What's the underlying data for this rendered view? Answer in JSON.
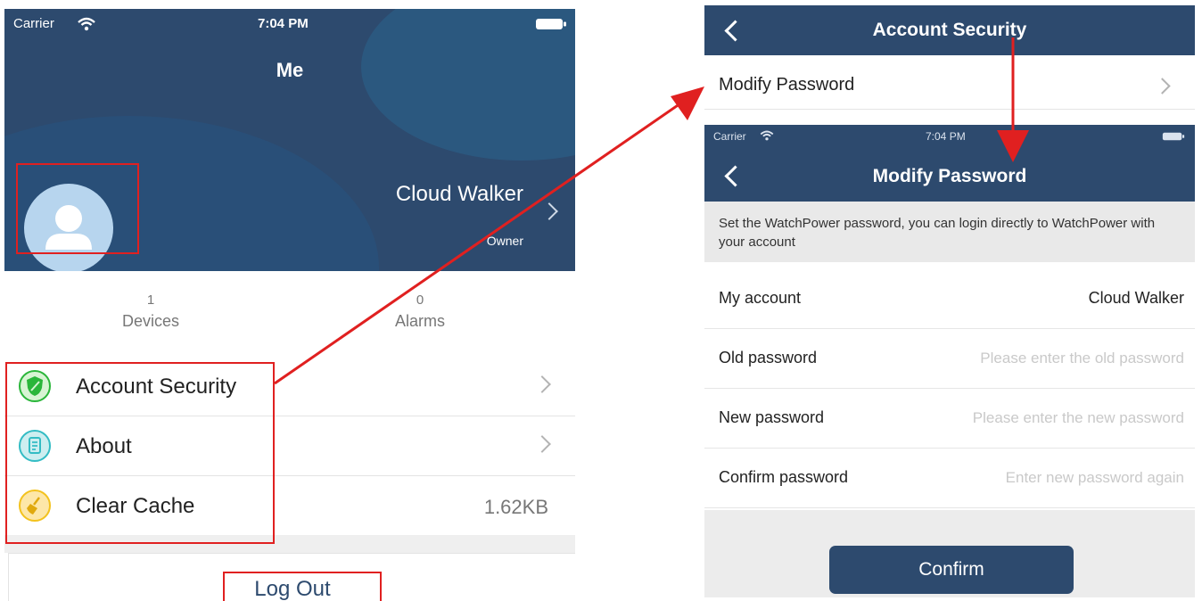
{
  "me": {
    "status": {
      "carrier": "Carrier",
      "time": "7:04 PM"
    },
    "title": "Me",
    "user": {
      "name": "Cloud Walker",
      "role": "Owner"
    },
    "stats": [
      {
        "value": "1",
        "label": "Devices"
      },
      {
        "value": "0",
        "label": "Alarms"
      }
    ],
    "menu": [
      {
        "label": "Account Security",
        "icon": "shield-icon"
      },
      {
        "label": "About",
        "icon": "document-icon"
      },
      {
        "label": "Clear Cache",
        "icon": "broom-icon",
        "value": "1.62KB"
      }
    ],
    "logout": "Log Out"
  },
  "account_security": {
    "title": "Account Security",
    "items": [
      {
        "label": "Modify Password"
      }
    ]
  },
  "modify_password": {
    "status": {
      "carrier": "Carrier",
      "time": "7:04 PM"
    },
    "title": "Modify Password",
    "info": "Set the WatchPower password, you can login directly to WatchPower with your account",
    "fields": [
      {
        "label": "My account",
        "value": "Cloud Walker"
      },
      {
        "label": "Old password",
        "placeholder": "Please enter the old password"
      },
      {
        "label": "New password",
        "placeholder": "Please enter the new password"
      },
      {
        "label": "Confirm password",
        "placeholder": "Enter new password again"
      }
    ],
    "confirm": "Confirm"
  },
  "colors": {
    "header": "#2d4a6e",
    "annotation": "#e02020"
  }
}
